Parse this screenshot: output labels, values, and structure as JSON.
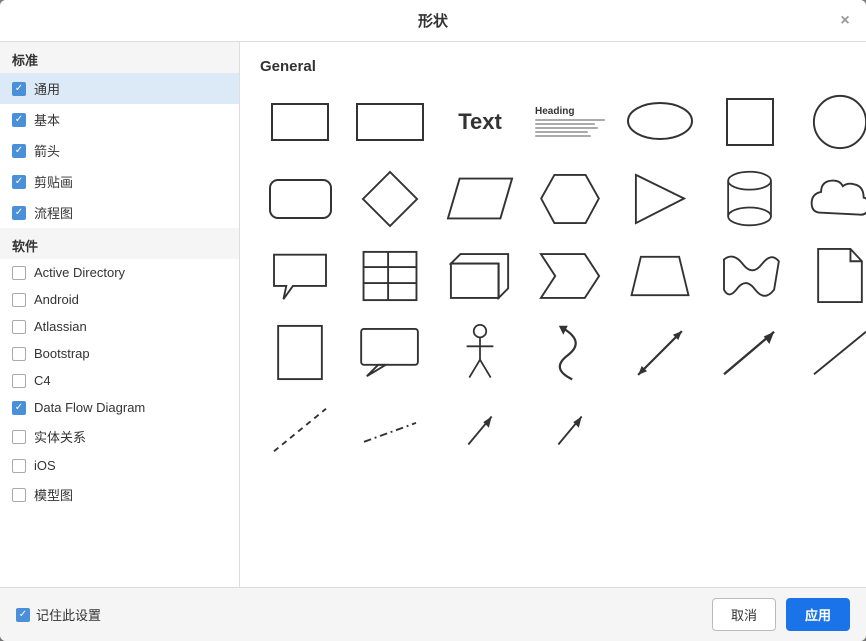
{
  "dialog": {
    "title": "形状",
    "close_label": "×"
  },
  "sidebar": {
    "standard_header": "标准",
    "software_header": "软件",
    "standard_items": [
      {
        "id": "general",
        "label": "通用",
        "checked": true
      },
      {
        "id": "basic",
        "label": "基本",
        "checked": true
      },
      {
        "id": "arrow",
        "label": "箭头",
        "checked": true
      },
      {
        "id": "clipart",
        "label": "剪贴画",
        "checked": true
      },
      {
        "id": "flowchart",
        "label": "流程图",
        "checked": true
      }
    ],
    "software_items": [
      {
        "id": "active-directory",
        "label": "Active Directory",
        "checked": false
      },
      {
        "id": "android",
        "label": "Android",
        "checked": false
      },
      {
        "id": "atlassian",
        "label": "Atlassian",
        "checked": false
      },
      {
        "id": "bootstrap",
        "label": "Bootstrap",
        "checked": false
      },
      {
        "id": "c4",
        "label": "C4",
        "checked": false
      },
      {
        "id": "data-flow",
        "label": "Data Flow Diagram",
        "checked": true
      },
      {
        "id": "er",
        "label": "实体关系",
        "checked": false
      },
      {
        "id": "ios",
        "label": "iOS",
        "checked": false
      },
      {
        "id": "mockup",
        "label": "模型图",
        "checked": false
      }
    ]
  },
  "main": {
    "section_title": "General"
  },
  "footer": {
    "remember_label": "记住此设置",
    "remember_checked": true,
    "cancel_label": "取消",
    "apply_label": "应用"
  }
}
